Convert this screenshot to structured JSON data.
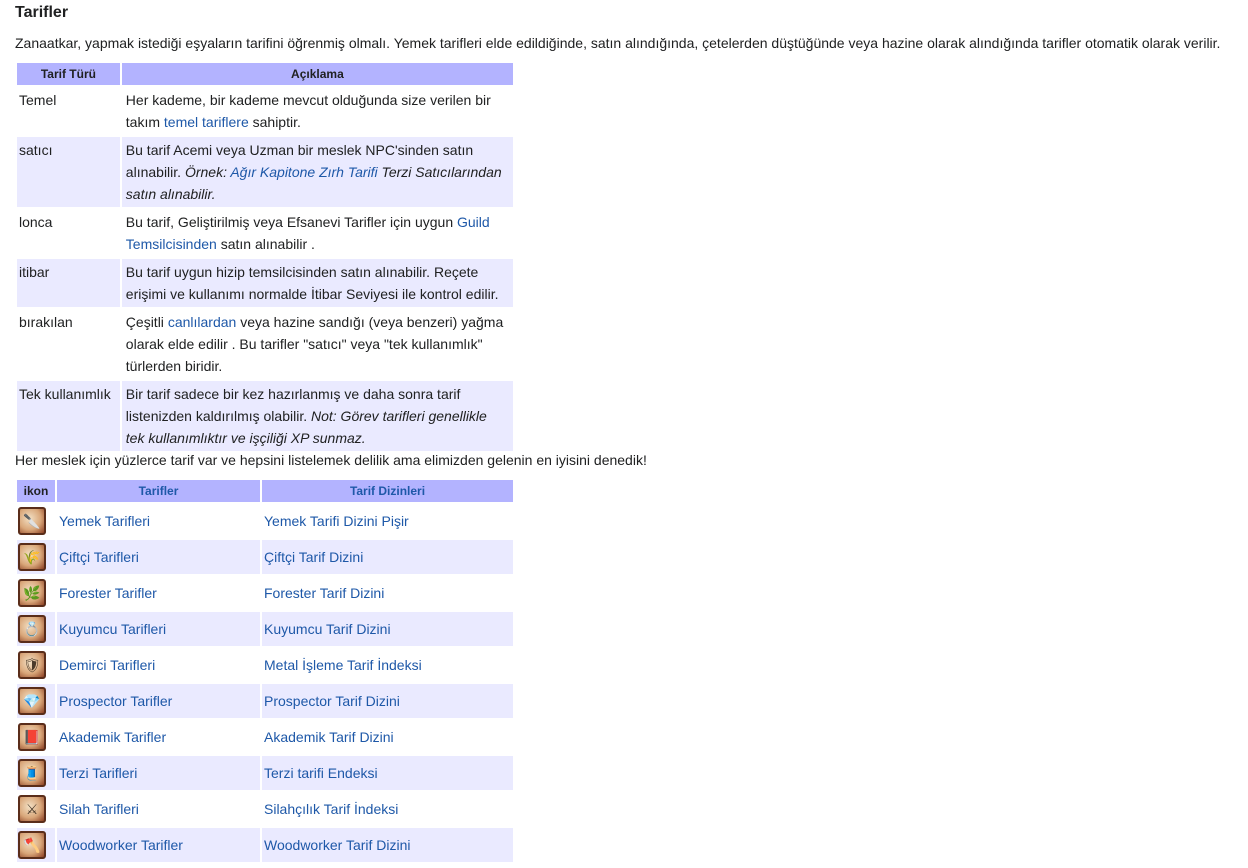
{
  "heading": "Tarifler",
  "intro": "Zanaatkar, yapmak istediği eşyaların tarifini öğrenmiş olmalı. Yemek tarifleri elde edildiğinde, satın alındığında, çetelerden düştüğünde veya hazine olarak alındığında tarifler otomatik olarak verilir.",
  "recipe_table": {
    "headers": [
      "Tarif Türü",
      "Açıklama"
    ],
    "rows": [
      {
        "type": "Temel",
        "desc_a": "Her kademe, bir kademe mevcut olduğunda size verilen bir takım ",
        "link": "temel tariflere",
        "desc_b": " sahiptir."
      },
      {
        "type": "satıcı",
        "desc_a": "Bu tarif Acemi veya Uzman bir meslek NPC'sinden satın alınabilir. ",
        "italic_a": "Örnek: ",
        "link": "Ağır Kapitone Zırh Tarifi",
        "italic_b": " Terzi Satıcılarından satın alınabilir."
      },
      {
        "type": "lonca",
        "desc_a": "Bu tarif, Geliştirilmiş veya Efsanevi Tarifler için uygun ",
        "link": "Guild Temsilcisinden",
        "desc_b": " satın alınabilir ."
      },
      {
        "type": "itibar",
        "desc_a": "Bu tarif uygun hizip temsilcisinden satın alınabilir. Reçete erişimi ve kullanımı normalde İtibar Seviyesi ile kontrol edilir."
      },
      {
        "type": "bırakılan",
        "desc_a": "Çeşitli ",
        "link": "canlılardan",
        "desc_b": " veya hazine sandığı (veya benzeri) yağma olarak elde edilir . Bu tarifler \"satıcı\" veya \"tek kullanımlık\" türlerden biridir."
      },
      {
        "type": "Tek kullanımlık",
        "desc_a": "Bir tarif sadece bir kez hazırlanmış ve daha sonra tarif listenizden kaldırılmış olabilir. ",
        "italic_a": "Not: Görev tarifleri genellikle tek kullanımlıktır ve işçiliği XP sunmaz."
      }
    ]
  },
  "note": "Her meslek için yüzlerce tarif var ve hepsini listelemek delilik ama elimizden gelenin en iyisini denedik!",
  "directory_table": {
    "headers": [
      "ikon",
      "Tarifler",
      "Tarif Dizinleri"
    ],
    "rows": [
      {
        "icon": "cooking-icon",
        "glyph": "🔪",
        "recipe": "Yemek Tarifleri",
        "index": "Yemek Tarifi Dizini Pişir"
      },
      {
        "icon": "farming-icon",
        "glyph": "🌾",
        "recipe": "Çiftçi Tarifleri",
        "index": "Çiftçi Tarif Dizini"
      },
      {
        "icon": "forester-icon",
        "glyph": "🌿",
        "recipe": "Forester Tarifler",
        "index": "Forester Tarif Dizini"
      },
      {
        "icon": "jeweler-icon",
        "glyph": "💍",
        "recipe": "Kuyumcu Tarifleri",
        "index": "Kuyumcu Tarif Dizini"
      },
      {
        "icon": "smith-icon",
        "glyph": "🛡",
        "recipe": "Demirci Tarifleri",
        "index": "Metal İşleme Tarif İndeksi"
      },
      {
        "icon": "prospector-icon",
        "glyph": "💎",
        "recipe": "Prospector Tarifler",
        "index": "Prospector Tarif Dizini"
      },
      {
        "icon": "scholar-icon",
        "glyph": "📕",
        "recipe": "Akademik Tarifler",
        "index": "Akademik Tarif Dizini"
      },
      {
        "icon": "tailor-icon",
        "glyph": "🧵",
        "recipe": "Terzi Tarifleri",
        "index": "Terzi tarifi Endeksi"
      },
      {
        "icon": "weapon-icon",
        "glyph": "⚔",
        "recipe": "Silah Tarifleri",
        "index": "Silahçılık Tarif İndeksi"
      },
      {
        "icon": "woodworker-icon",
        "glyph": "🪓",
        "recipe": "Woodworker Tarifler",
        "index": "Woodworker Tarif Dizini"
      }
    ]
  }
}
